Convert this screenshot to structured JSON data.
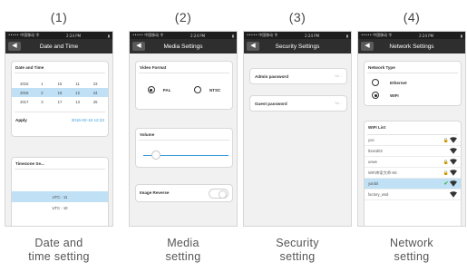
{
  "status_bar": {
    "carrier": "••••• 中国移动 令",
    "time": "2:24 PM",
    "battery": "▮"
  },
  "panels": [
    {
      "number": "(1)",
      "title": "Date and Time",
      "caption": [
        "Date and",
        "time setting"
      ]
    },
    {
      "number": "(2)",
      "title": "Media Settings",
      "caption": [
        "Media",
        "setting"
      ]
    },
    {
      "number": "(3)",
      "title": "Security Settings",
      "caption": [
        "Security",
        "setting"
      ]
    },
    {
      "number": "(4)",
      "title": "Network Settings",
      "caption": [
        "Network",
        "setting"
      ]
    }
  ],
  "date_time": {
    "card_title": "Date and Time",
    "rows": [
      [
        "2015",
        "1",
        "15",
        "11",
        "23"
      ],
      [
        "2016",
        "2",
        "16",
        "12",
        "24"
      ],
      [
        "2017",
        "3",
        "17",
        "13",
        "25"
      ]
    ],
    "apply_label": "Apply",
    "current_value": "2016-02-16 12:23",
    "timezone_title": "Timezone Se...",
    "timezones": [
      "UTC - 11",
      "UTC - 10"
    ]
  },
  "media": {
    "video_format_title": "Video Format",
    "options": [
      "PAL",
      "NTSC"
    ],
    "selected": "PAL",
    "volume_title": "Volume",
    "volume_level": 0.15,
    "image_reverse_label": "Image Reverse"
  },
  "security": {
    "admin_label": "Admin password",
    "guest_label": "Guest password",
    "hint": "Se..."
  },
  "network": {
    "type_title": "Network Type",
    "options": [
      "Ethernet",
      "WIFI"
    ],
    "selected": "WIFI",
    "wifi_list_title": "WIFI List",
    "networks": [
      {
        "name": "yoo",
        "locked": true,
        "connected": false
      },
      {
        "name": "ltzand02",
        "locked": false,
        "connected": false
      },
      {
        "name": "uewe",
        "locked": true,
        "connected": false
      },
      {
        "name": "WiFi库家大师-8S",
        "locked": true,
        "connected": false
      },
      {
        "name": "yanbit",
        "locked": false,
        "connected": true
      },
      {
        "name": "factory_wsd",
        "locked": false,
        "connected": false
      }
    ]
  },
  "colors": {
    "navbar": "#2e2e2e",
    "selection": "#bfe0f5",
    "accent": "#3b9bd9"
  }
}
